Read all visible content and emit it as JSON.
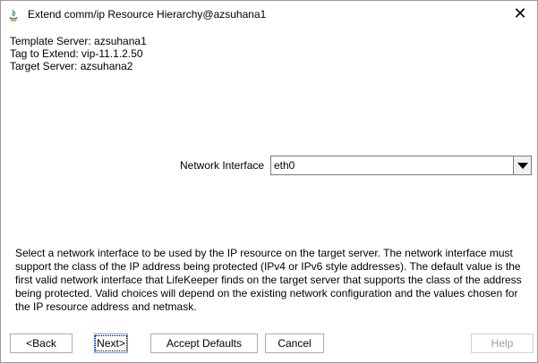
{
  "window": {
    "title": "Extend comm/ip Resource Hierarchy@azsuhana1",
    "close_glyph": "✕"
  },
  "info": {
    "template_server": "Template Server: azsuhana1",
    "tag_to_extend": "Tag to Extend: vip-11.1.2.50",
    "target_server": "Target Server: azsuhana2"
  },
  "network_interface": {
    "label": "Network Interface",
    "value": "eth0"
  },
  "help_text": "Select a network interface to be used by the IP resource on the target server. The network interface must support the class of the IP address being protected (IPv4 or IPv6 style addresses). The default value is the first valid network interface that LifeKeeper finds on the target server that supports the class of the address being protected. Valid choices will depend on the existing network configuration and the values chosen for the IP resource address and netmask.",
  "buttons": {
    "back": "<Back",
    "next": "Next>",
    "accept_defaults": "Accept Defaults",
    "cancel": "Cancel",
    "help": "Help"
  }
}
